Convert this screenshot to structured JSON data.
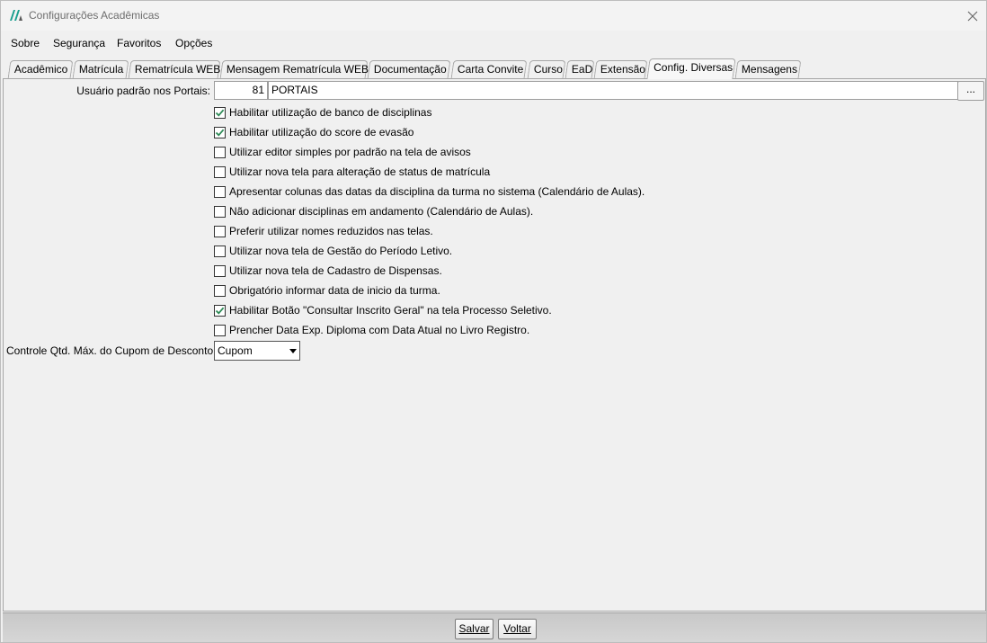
{
  "window": {
    "title": "Configurações Acadêmicas",
    "accent_color": "#1a9e8f"
  },
  "menu": [
    {
      "label": "Sobre"
    },
    {
      "label": "Segurança"
    },
    {
      "label": "Favoritos"
    },
    {
      "label": "Opções"
    }
  ],
  "tabs": [
    {
      "label": "Acadêmico"
    },
    {
      "label": "Matrícula"
    },
    {
      "label": "Rematrícula WEB"
    },
    {
      "label": "Mensagem Rematrícula WEB"
    },
    {
      "label": "Documentação"
    },
    {
      "label": "Carta Convite"
    },
    {
      "label": "Curso"
    },
    {
      "label": "EaD"
    },
    {
      "label": "Extensão"
    },
    {
      "label": "Config. Diversas",
      "active": true
    },
    {
      "label": "Mensagens"
    }
  ],
  "portal_user": {
    "label": "Usuário padrão nos Portais:",
    "code": "81",
    "name": "PORTAIS",
    "lookup_button": "..."
  },
  "options": [
    {
      "label": "Habilitar utilização de banco de disciplinas",
      "checked": true
    },
    {
      "label": "Habilitar utilização do score de evasão",
      "checked": true
    },
    {
      "label": "Utilizar editor simples por padrão na tela de avisos",
      "checked": false
    },
    {
      "label": "Utilizar nova tela para alteração de status de matrícula",
      "checked": false
    },
    {
      "label": "Apresentar colunas das datas da disciplina da turma no sistema (Calendário de Aulas).",
      "checked": false
    },
    {
      "label": "Não adicionar disciplinas em andamento (Calendário de Aulas).",
      "checked": false
    },
    {
      "label": "Preferir utilizar nomes reduzidos nas telas.",
      "checked": false
    },
    {
      "label": "Utilizar nova tela de Gestão do Período Letivo.",
      "checked": false
    },
    {
      "label": "Utilizar nova tela de Cadastro de Dispensas.",
      "checked": false
    },
    {
      "label": "Obrigatório informar data de inicio da turma.",
      "checked": false
    },
    {
      "label": "Habilitar Botão \"Consultar Inscrito Geral\" na tela Processo Seletivo.",
      "checked": true
    },
    {
      "label": "Prencher Data Exp. Diploma com Data Atual no Livro Registro.",
      "checked": false
    }
  ],
  "coupon_control": {
    "label": "Controle Qtd. Máx. do Cupom de Desconto",
    "selected": "Cupom"
  },
  "footer": {
    "save_label": "Salvar",
    "back_label": "Voltar"
  }
}
